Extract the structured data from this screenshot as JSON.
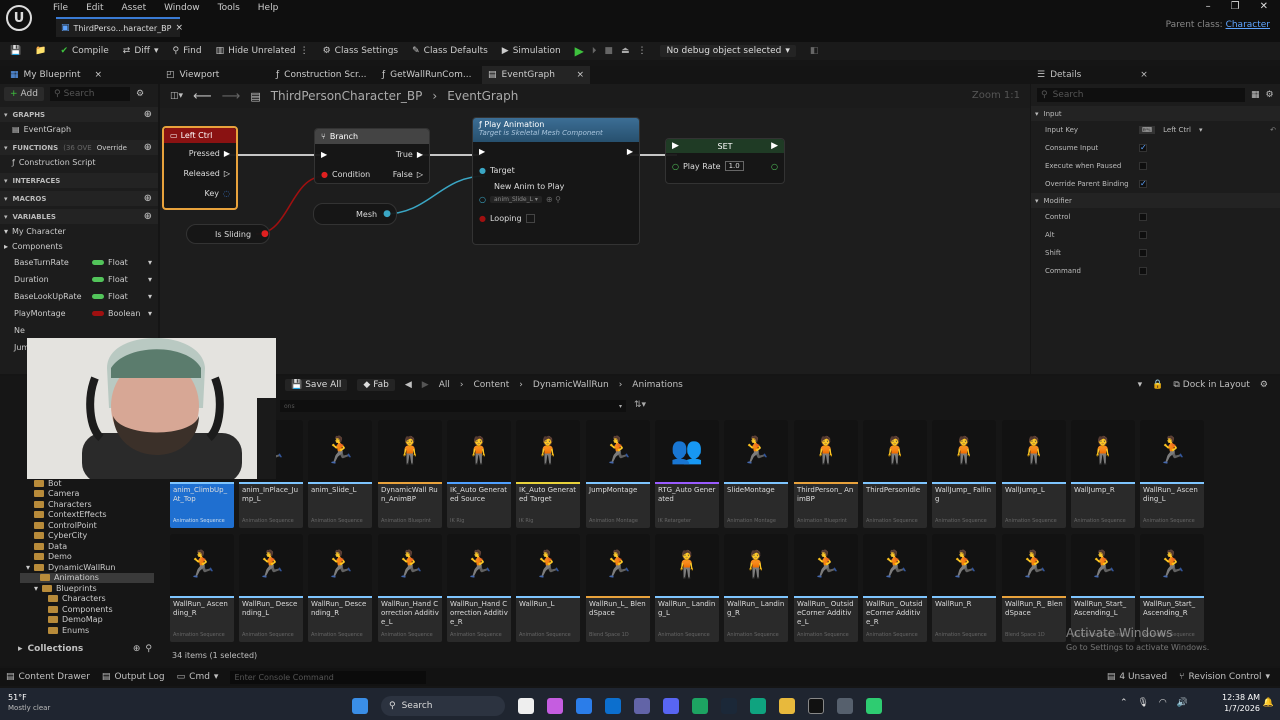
{
  "titlebar": {
    "menus": [
      "File",
      "Edit",
      "Asset",
      "Window",
      "Tools",
      "Help"
    ],
    "tab": "ThirdPerso...haracter_BP",
    "close": "×",
    "parent_label": "Parent class:",
    "parent_value": "Character",
    "win_min": "–",
    "win_max": "❐",
    "win_close": "✕"
  },
  "toolbar": {
    "compile": "Compile",
    "diff": "Diff",
    "find": "Find",
    "hide_unrelated": "Hide Unrelated",
    "class_settings": "Class Settings",
    "class_defaults": "Class Defaults",
    "simulation": "Simulation",
    "debug": "No debug object selected"
  },
  "panel_tabs": {
    "my_blueprint": "My Blueprint",
    "viewport": "Viewport",
    "construction": "Construction Scr...",
    "getwall": "GetWallRunCom...",
    "eventgraph": "EventGraph",
    "details": "Details"
  },
  "my_blueprint": {
    "add": "Add",
    "search_placeholder": "Search",
    "graphs": "GRAPHS",
    "event_graph": "EventGraph",
    "functions": "FUNCTIONS",
    "functions_override": "(36 OVE",
    "override": "Override",
    "construction_script": "Construction Script",
    "interfaces": "INTERFACES",
    "macros": "MACROS",
    "variables": "VARIABLES",
    "my_character": "My Character",
    "components": "Components",
    "vars": [
      {
        "name": "BaseTurnRate",
        "type": "Float",
        "color": "#52c45a"
      },
      {
        "name": "Duration",
        "type": "Float",
        "color": "#52c45a"
      },
      {
        "name": "BaseLookUpRate",
        "type": "Float",
        "color": "#52c45a"
      },
      {
        "name": "PlayMontage",
        "type": "Boolean",
        "color": "#a01010"
      }
    ],
    "cut1": "Ne",
    "cut2": "Jum"
  },
  "graph": {
    "bp_name": "ThirdPersonCharacter_BP",
    "graph_name": "EventGraph",
    "zoom": "Zoom 1:1",
    "left_ctrl": {
      "title": "Left Ctrl",
      "pressed": "Pressed",
      "released": "Released",
      "key": "Key"
    },
    "branch": {
      "title": "Branch",
      "condition": "Condition",
      "true": "True",
      "false": "False"
    },
    "is_sliding": "Is Sliding",
    "mesh": "Mesh",
    "play_anim": {
      "title": "Play Animation",
      "subtitle": "Target is Skeletal Mesh Component",
      "target": "Target",
      "new_anim": "New Anim to Play",
      "anim_value": "anim_Slide_L",
      "looping": "Looping"
    },
    "set": {
      "title": "SET",
      "play_rate": "Play Rate",
      "value": "1.0"
    }
  },
  "details": {
    "search_placeholder": "Search",
    "input": "Input",
    "input_key": "Input Key",
    "key_value": "Left Ctrl",
    "modifier": "Modifier",
    "props": [
      {
        "name": "Consume Input",
        "checked": "✓"
      },
      {
        "name": "Execute when Paused",
        "checked": ""
      },
      {
        "name": "Override Parent Binding",
        "checked": "✓"
      }
    ],
    "mods": [
      {
        "name": "Control"
      },
      {
        "name": "Alt"
      },
      {
        "name": "Shift"
      },
      {
        "name": "Command"
      }
    ]
  },
  "content": {
    "save_all": "Save All",
    "fab": "Fab",
    "crumbs": [
      "All",
      "Content",
      "DynamicWallRun",
      "Animations"
    ],
    "dock": "Dock in Layout",
    "search_placeholder": "ons",
    "folders": [
      "Bot",
      "Camera",
      "Characters",
      "ContextEffects",
      "ControlPoint",
      "CyberCity",
      "Data",
      "Demo",
      "DynamicWallRun",
      "Animations",
      "Blueprints",
      "Characters",
      "Components",
      "DemoMap",
      "Enums"
    ],
    "collections": "Collections",
    "count": "34 items (1 selected)",
    "row1": [
      {
        "label": "anim_ClimbUp_At_Top",
        "type": "Animation Sequence",
        "color": "#7ec5ff",
        "glyph": "🏃"
      },
      {
        "label": "anim_InPlace_Jump_L",
        "type": "Animation Sequence",
        "color": "#7ec5ff",
        "glyph": "🏃"
      },
      {
        "label": "anim_Slide_L",
        "type": "Animation Sequence",
        "color": "#7ec5ff",
        "glyph": "🏃"
      },
      {
        "label": "DynamicWall Run_AnimBP",
        "type": "Animation Blueprint",
        "color": "#e8a23c",
        "glyph": "🧍"
      },
      {
        "label": "IK_Auto Generated Source",
        "type": "IK Rig",
        "color": "#4fa0ff",
        "glyph": "🧍"
      },
      {
        "label": "IK_Auto Generated Target",
        "type": "IK Rig",
        "color": "#e8d23c",
        "glyph": "🧍"
      },
      {
        "label": "JumpMontage",
        "type": "Animation Montage",
        "color": "#7ec5ff",
        "glyph": "🏃"
      },
      {
        "label": "RTG_Auto Generated",
        "type": "IK Retargeter",
        "color": "#9a5cff",
        "glyph": "👥"
      },
      {
        "label": "SlideMontage",
        "type": "Animation Montage",
        "color": "#7ec5ff",
        "glyph": "🏃"
      },
      {
        "label": "ThirdPerson_ AnimBP",
        "type": "Animation Blueprint",
        "color": "#e8a23c",
        "glyph": "🧍"
      },
      {
        "label": "ThirdPersonIdle",
        "type": "Animation Sequence",
        "color": "#7ec5ff",
        "glyph": "🧍"
      },
      {
        "label": "WallJump_ Falling",
        "type": "Animation Sequence",
        "color": "#7ec5ff",
        "glyph": "🧍"
      },
      {
        "label": "WallJump_L",
        "type": "Animation Sequence",
        "color": "#7ec5ff",
        "glyph": "🧍"
      },
      {
        "label": "WallJump_R",
        "type": "Animation Sequence",
        "color": "#7ec5ff",
        "glyph": "🧍"
      },
      {
        "label": "WallRun_ Ascending_L",
        "type": "Animation Sequence",
        "color": "#7ec5ff",
        "glyph": "🏃"
      }
    ],
    "row2": [
      {
        "label": "WallRun_ Ascending_R",
        "type": "Animation Sequence",
        "color": "#7ec5ff",
        "glyph": "🏃"
      },
      {
        "label": "WallRun_ Descending_L",
        "type": "Animation Sequence",
        "color": "#7ec5ff",
        "glyph": "🏃"
      },
      {
        "label": "WallRun_ Descending_R",
        "type": "Animation Sequence",
        "color": "#7ec5ff",
        "glyph": "🏃"
      },
      {
        "label": "WallRun_Hand Correction Additive_L",
        "type": "Animation Sequence",
        "color": "#7ec5ff",
        "glyph": "🏃"
      },
      {
        "label": "WallRun_Hand Correction Additive_R",
        "type": "Animation Sequence",
        "color": "#7ec5ff",
        "glyph": "🏃"
      },
      {
        "label": "WallRun_L",
        "type": "Animation Sequence",
        "color": "#7ec5ff",
        "glyph": "🏃"
      },
      {
        "label": "WallRun_L_ BlendSpace",
        "type": "Blend Space 1D",
        "color": "#e8a23c",
        "glyph": "🏃"
      },
      {
        "label": "WallRun_ Landing_L",
        "type": "Animation Sequence",
        "color": "#7ec5ff",
        "glyph": "🧍"
      },
      {
        "label": "WallRun_ Landing_R",
        "type": "Animation Sequence",
        "color": "#7ec5ff",
        "glyph": "🧍"
      },
      {
        "label": "WallRun_ OutsideCorner Additive_L",
        "type": "Animation Sequence",
        "color": "#7ec5ff",
        "glyph": "🏃"
      },
      {
        "label": "WallRun_ OutsideCorner Additive_R",
        "type": "Animation Sequence",
        "color": "#7ec5ff",
        "glyph": "🏃"
      },
      {
        "label": "WallRun_R",
        "type": "Animation Sequence",
        "color": "#7ec5ff",
        "glyph": "🏃"
      },
      {
        "label": "WallRun_R_ BlendSpace",
        "type": "Blend Space 1D",
        "color": "#e8a23c",
        "glyph": "🏃"
      },
      {
        "label": "WallRun_Start_ Ascending_L",
        "type": "Animation Sequence",
        "color": "#7ec5ff",
        "glyph": "🏃"
      },
      {
        "label": "WallRun_Start_ Ascending_R",
        "type": "Animation Sequence",
        "color": "#7ec5ff",
        "glyph": "🏃"
      }
    ]
  },
  "status": {
    "content_drawer": "Content Drawer",
    "output_log": "Output Log",
    "cmd": "Cmd",
    "console_placeholder": "Enter Console Command",
    "unsaved": "4 Unsaved",
    "revision": "Revision Control"
  },
  "watermark": {
    "title": "Activate Windows",
    "sub": "Go to Settings to activate Windows."
  },
  "taskbar": {
    "temp": "51°F",
    "weather": "Mostly clear",
    "search": "Search",
    "time": "12:38 AM",
    "date": "1/7/2026"
  }
}
